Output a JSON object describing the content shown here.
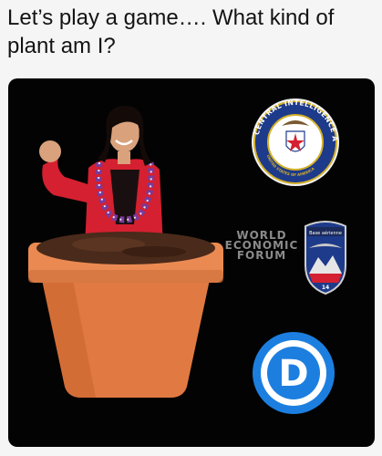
{
  "post": {
    "caption": "Let’s play a game…. What kind of plant am I?"
  },
  "logos": {
    "cia_seal": {
      "name": "cia-seal",
      "ring_text": "CENTRAL INTELLIGENCE AGENCY",
      "bottom_text": "UNITED STATES OF AMERICA"
    },
    "wef": {
      "name": "world-economic-forum-logo",
      "lines": [
        "WORLD",
        "ECONOMIC",
        "FORUM"
      ]
    },
    "air_base_patch": {
      "name": "air-base-patch",
      "top_text": "Base aérienne",
      "number": "14"
    },
    "democratic_logo": {
      "name": "democratic-party-logo",
      "letter": "D"
    }
  },
  "colors": {
    "background": "#f5f5f5",
    "panel": "#030303",
    "pot": "#e07a42",
    "pot_rim": "#ea8a52",
    "soil": "#4a2a1a",
    "blazer": "#d42030",
    "lei": "#7a3a9a",
    "cia_blue": "#1e3a8a",
    "cia_gold": "#d4b028",
    "democrat_blue": "#1c7fe0",
    "wef_gray": "#8a8a8a"
  }
}
